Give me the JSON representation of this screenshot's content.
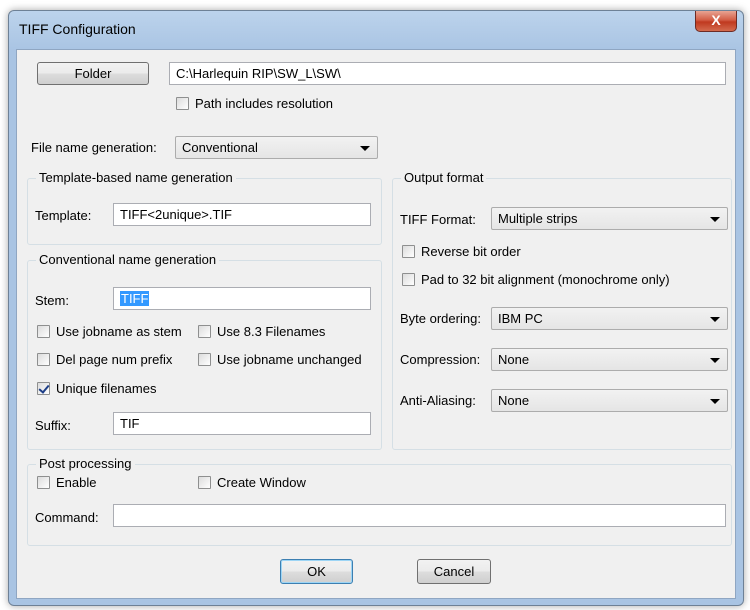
{
  "window": {
    "title": "TIFF Configuration",
    "close_glyph": "X"
  },
  "folder": {
    "button_label": "Folder",
    "path_value": "C:\\Harlequin RIP\\SW_L\\SW\\",
    "path_includes_resolution": {
      "label": "Path includes resolution",
      "checked": false
    }
  },
  "file_name_generation": {
    "label": "File name generation:",
    "selected": "Conventional"
  },
  "template_group": {
    "legend": "Template-based name generation",
    "template_label": "Template:",
    "template_value": "TIFF<2unique>.TIF"
  },
  "conventional_group": {
    "legend": "Conventional name generation",
    "stem_label": "Stem:",
    "stem_value": "TIFF",
    "use_jobname_as_stem": {
      "label": "Use jobname as stem",
      "checked": false
    },
    "use_83_filenames": {
      "label": "Use 8.3 Filenames",
      "checked": false
    },
    "del_page_num_prefix": {
      "label": "Del page num prefix",
      "checked": false
    },
    "use_jobname_unchanged": {
      "label": "Use jobname unchanged",
      "checked": false
    },
    "unique_filenames": {
      "label": "Unique filenames",
      "checked": true
    },
    "suffix_label": "Suffix:",
    "suffix_value": "TIF"
  },
  "output_format": {
    "legend": "Output format",
    "tiff_format_label": "TIFF Format:",
    "tiff_format_value": "Multiple strips",
    "reverse_bit_order": {
      "label": "Reverse bit order",
      "checked": false
    },
    "pad_32bit": {
      "label": "Pad to 32 bit alignment (monochrome only)",
      "checked": false
    },
    "byte_ordering_label": "Byte ordering:",
    "byte_ordering_value": "IBM PC",
    "compression_label": "Compression:",
    "compression_value": "None",
    "anti_aliasing_label": "Anti-Aliasing:",
    "anti_aliasing_value": "None"
  },
  "post_processing": {
    "legend": "Post processing",
    "enable": {
      "label": "Enable",
      "checked": false
    },
    "create_window": {
      "label": "Create Window",
      "checked": false
    },
    "command_label": "Command:",
    "command_value": ""
  },
  "buttons": {
    "ok": "OK",
    "cancel": "Cancel"
  }
}
